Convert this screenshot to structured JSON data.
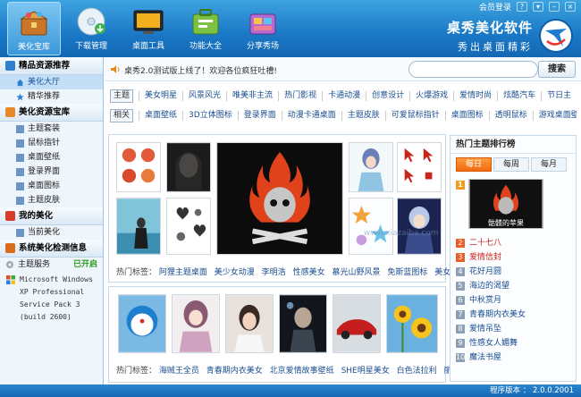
{
  "toolbar": {
    "items": [
      {
        "label": "美化宝库",
        "icon": "treasure-box-icon",
        "active": true
      },
      {
        "label": "下载管理",
        "icon": "download-disc-icon",
        "active": false
      },
      {
        "label": "桌面工具",
        "icon": "desktop-monitor-icon",
        "active": false
      },
      {
        "label": "功能大全",
        "icon": "function-toolbox-icon",
        "active": false
      },
      {
        "label": "分享秀场",
        "icon": "share-stage-icon",
        "active": false
      }
    ]
  },
  "topbar": {
    "login": "会员登录",
    "controls": [
      "?",
      "▾",
      "–",
      "×"
    ]
  },
  "brand": {
    "title": "桌秀美化软件",
    "slogan": "秀出桌面精彩",
    "logo_icon": "deskshow-logo-icon",
    "color_primary": "#1a78c6"
  },
  "sidebar": {
    "sections": [
      {
        "title": "精品资源推荐",
        "icon": "recommend-icon",
        "color": "#2d7fd0",
        "items": [
          {
            "label": "美化大厅",
            "icon": "house-icon",
            "active": true
          },
          {
            "label": "精华推荐",
            "icon": "star-icon",
            "active": false
          }
        ]
      },
      {
        "title": "美化资源宝库",
        "icon": "treasure-icon",
        "color": "#e9892a",
        "items": [
          {
            "label": "主题套装",
            "icon": "theme-pack-icon"
          },
          {
            "label": "鼠标指针",
            "icon": "mouse-pointer-icon"
          },
          {
            "label": "桌面壁纸",
            "icon": "wallpaper-icon"
          },
          {
            "label": "登录界面",
            "icon": "login-screen-icon"
          },
          {
            "label": "桌面图标",
            "icon": "desktop-icon-icon"
          },
          {
            "label": "主题皮肤",
            "icon": "skin-icon"
          }
        ]
      },
      {
        "title": "我的美化",
        "icon": "my-beautify-icon",
        "color": "#d93b2a",
        "items": [
          {
            "label": "当前美化",
            "icon": "current-icon"
          }
        ]
      },
      {
        "title": "系统美化检测信息",
        "icon": "system-check-icon",
        "color": "#d96b1a"
      }
    ],
    "detect": {
      "service_label": "主题服务",
      "service_status": "已开启",
      "os_lines": [
        "Microsoft Windows",
        "XP Professional",
        "Service Pack 3",
        "(build 2600)"
      ]
    }
  },
  "notice": {
    "text": "桌秀2.0测试版上线了！欢迎各位疯狂吐槽!",
    "search_placeholder": "",
    "search_button": "搜索"
  },
  "tags": {
    "row1": {
      "label": "主题",
      "items": [
        "美女明星",
        "风景风光",
        "唯美非主流",
        "热门影视",
        "卡通动漫",
        "创意设计",
        "火爆游戏",
        "爱情时尚",
        "炫酷汽车",
        "节日主"
      ]
    },
    "row2": {
      "label": "相关",
      "items": [
        "桌面壁纸",
        "3D立体图标",
        "登录界面",
        "动漫卡通桌面",
        "主题皮肤",
        "可爱鼠标指针",
        "桌面图标",
        "透明鼠标",
        "游戏桌面壁"
      ]
    }
  },
  "panel1": {
    "hot_label": "热门标签：",
    "hot_tags": [
      "阿狸主题桌面",
      "美少女动漫",
      "李明浩",
      "性感美女",
      "慕光山野风景",
      "免斯蓝图标",
      "美女登录界面"
    ]
  },
  "panel2": {
    "hot_label": "热门标签：",
    "hot_tags": [
      "海贼王全员",
      "青春期内衣美女",
      "北京爱情故事壁纸",
      "SHE明星美女",
      "白色法拉利",
      "丽江风景",
      "青"
    ]
  },
  "watermark": "www.xiazaiba.com",
  "ranking": {
    "title": "热门主题排行榜",
    "tabs": [
      {
        "label": "每日",
        "on": true
      },
      {
        "label": "每周",
        "on": false
      },
      {
        "label": "每月",
        "on": false
      }
    ],
    "first": {
      "num": "1",
      "caption": "骷髅的苹果"
    },
    "rows": [
      {
        "num": "2",
        "title": "二十七八",
        "hot": true,
        "red": true
      },
      {
        "num": "3",
        "title": "爱情信封",
        "hot": true,
        "red": true
      },
      {
        "num": "4",
        "title": "花好月圆",
        "hot": false,
        "red": false
      },
      {
        "num": "5",
        "title": "海边的渴望",
        "hot": false,
        "red": false
      },
      {
        "num": "6",
        "title": "中秋赏月",
        "hot": false,
        "red": false
      },
      {
        "num": "7",
        "title": "青春期内衣美女",
        "hot": false,
        "red": false
      },
      {
        "num": "8",
        "title": "爱情吊坠",
        "hot": false,
        "red": false
      },
      {
        "num": "9",
        "title": "性感女人媚舞",
        "hot": false,
        "red": false
      },
      {
        "num": "10",
        "title": "魔法书屋",
        "hot": false,
        "red": false
      }
    ]
  },
  "status": {
    "version": "程序版本 ： 2.0.0.2001"
  }
}
